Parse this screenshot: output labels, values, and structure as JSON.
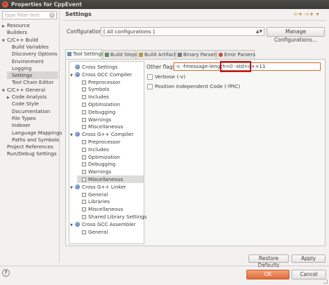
{
  "window": {
    "title": "Properties for CppEvent"
  },
  "filter": {
    "placeholder": "type filter text"
  },
  "nav": {
    "items": [
      {
        "label": "Resource",
        "arrow": "▶"
      },
      {
        "label": "Builders",
        "arrow": ""
      },
      {
        "label": "C/C++ Build",
        "arrow": "▼"
      },
      {
        "label": "Build Variables",
        "arrow": ""
      },
      {
        "label": "Discovery Options",
        "arrow": ""
      },
      {
        "label": "Environment",
        "arrow": ""
      },
      {
        "label": "Logging",
        "arrow": ""
      },
      {
        "label": "Settings",
        "arrow": ""
      },
      {
        "label": "Tool Chain Editor",
        "arrow": ""
      },
      {
        "label": "C/C++ General",
        "arrow": "▼"
      },
      {
        "label": "Code Analysis",
        "arrow": "▶"
      },
      {
        "label": "Code Style",
        "arrow": ""
      },
      {
        "label": "Documentation",
        "arrow": ""
      },
      {
        "label": "File Types",
        "arrow": ""
      },
      {
        "label": "Indexer",
        "arrow": ""
      },
      {
        "label": "Language Mappings",
        "arrow": ""
      },
      {
        "label": "Paths and Symbols",
        "arrow": ""
      },
      {
        "label": "Project References",
        "arrow": ""
      },
      {
        "label": "Run/Debug Settings",
        "arrow": ""
      }
    ]
  },
  "main": {
    "heading": "Settings",
    "configuration_label": "Configuration:",
    "configuration_value": "[ All configurations ]",
    "manage_button": "Manage Configurations...",
    "tabs": [
      {
        "label": "Tool Settings"
      },
      {
        "label": "Build Steps"
      },
      {
        "label": "Build Artifact"
      },
      {
        "label": "Binary Parsers"
      },
      {
        "label": "Error Parsers"
      }
    ],
    "tree": [
      {
        "label": "Cross Settings",
        "arrow": ""
      },
      {
        "label": "Cross GCC Compiler",
        "arrow": "▼"
      },
      {
        "label": "Preprocessor",
        "arrow": ""
      },
      {
        "label": "Symbols",
        "arrow": ""
      },
      {
        "label": "Includes",
        "arrow": ""
      },
      {
        "label": "Optimization",
        "arrow": ""
      },
      {
        "label": "Debugging",
        "arrow": ""
      },
      {
        "label": "Warnings",
        "arrow": ""
      },
      {
        "label": "Miscellaneous",
        "arrow": ""
      },
      {
        "label": "Cross G++ Compiler",
        "arrow": "▼"
      },
      {
        "label": "Preprocessor",
        "arrow": ""
      },
      {
        "label": "Includes",
        "arrow": ""
      },
      {
        "label": "Optimization",
        "arrow": ""
      },
      {
        "label": "Debugging",
        "arrow": ""
      },
      {
        "label": "Warnings",
        "arrow": ""
      },
      {
        "label": "Miscellaneous",
        "arrow": ""
      },
      {
        "label": "Cross G++ Linker",
        "arrow": "▼"
      },
      {
        "label": "General",
        "arrow": ""
      },
      {
        "label": "Libraries",
        "arrow": ""
      },
      {
        "label": "Miscellaneous",
        "arrow": ""
      },
      {
        "label": "Shared Library Settings",
        "arrow": ""
      },
      {
        "label": "Cross GCC Assembler",
        "arrow": "▼"
      },
      {
        "label": "General",
        "arrow": ""
      }
    ],
    "other_flags_label": "Other flags",
    "other_flags_value": "-c -fmessage-length=0 -std=c++11",
    "verbose_label": "Verbose (-v)",
    "pic_label": "Position Independent Code (-fPIC)",
    "restore_button": "Restore Defaults",
    "apply_button": "Apply"
  },
  "footer": {
    "ok_button": "OK",
    "cancel_button": "Cancel",
    "help": "?"
  },
  "colors": {
    "accent": "#e06b38",
    "highlight_box": "#b8182a",
    "selection": "#dcdcd8"
  }
}
